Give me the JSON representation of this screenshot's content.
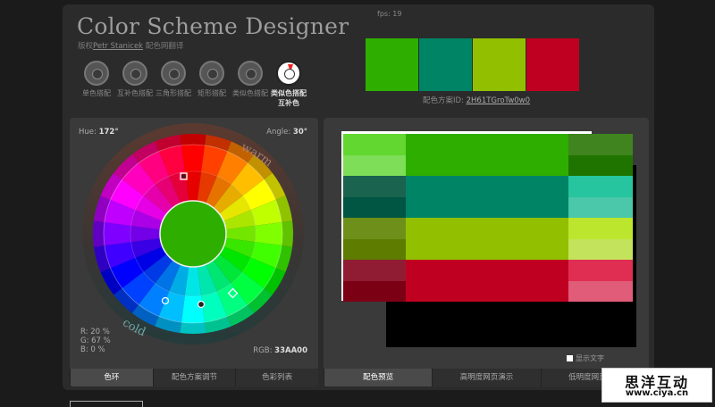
{
  "app": {
    "title": "Color Scheme Designer",
    "credit_prefix": "版权",
    "credit_author": "Petr Stanicek",
    "credit_suffix": "配色网翻译",
    "fps": "fps: 19"
  },
  "modes": [
    {
      "label": "单色搭配",
      "active": false
    },
    {
      "label": "互补色搭配",
      "active": false
    },
    {
      "label": "三角形搭配",
      "active": false
    },
    {
      "label": "矩形搭配",
      "active": false
    },
    {
      "label": "类似色搭配",
      "active": false
    },
    {
      "label": "类似色搭配互补色",
      "active": true
    }
  ],
  "swatches": [
    "#2EAF00",
    "#008466",
    "#92C000",
    "#C00020"
  ],
  "scheme_id": {
    "label": "配色方案ID: ",
    "value": "2H61TGroTw0w0"
  },
  "wheel": {
    "hue_label": "Hue:",
    "hue_value": "172°",
    "angle_label": "Angle:",
    "angle_value": "30°",
    "warm": "warm",
    "cold": "cold",
    "rgb_label": "RGB:",
    "rgb_value": "33AA00",
    "r": "R: 20 %",
    "g": "G: 67 %",
    "b": "B:   0 %",
    "center_color": "#2EAF00"
  },
  "left_tabs": [
    {
      "label": "色环",
      "active": true
    },
    {
      "label": "配色方案调节",
      "active": false
    },
    {
      "label": "色彩列表",
      "active": false
    }
  ],
  "right_tabs": [
    {
      "label": "配色预览",
      "active": true
    },
    {
      "label": "高明度网页演示",
      "active": false
    },
    {
      "label": "低明度网页演示",
      "active": false
    }
  ],
  "show_text": "显示文字",
  "palette": {
    "green": {
      "main": "#2EAF00",
      "light1": "#62D72F",
      "light2": "#7FDE57",
      "dark1": "#3F841F",
      "dark2": "#1F7400"
    },
    "teal": {
      "main": "#008466",
      "light1": "#26C59F",
      "light2": "#4BC7A9",
      "dark1": "#19634F",
      "dark2": "#005642"
    },
    "lime": {
      "main": "#92C000",
      "light1": "#BCE62E",
      "light2": "#C4E35C",
      "dark1": "#6E8F1A",
      "dark2": "#5E7C00"
    },
    "red": {
      "main": "#C00020",
      "light1": "#E02E53",
      "light2": "#E05C78",
      "dark1": "#901C33",
      "dark2": "#7C0014"
    }
  },
  "watermark": {
    "line1": "思洋互动",
    "line2": "www.ciya.cn"
  }
}
